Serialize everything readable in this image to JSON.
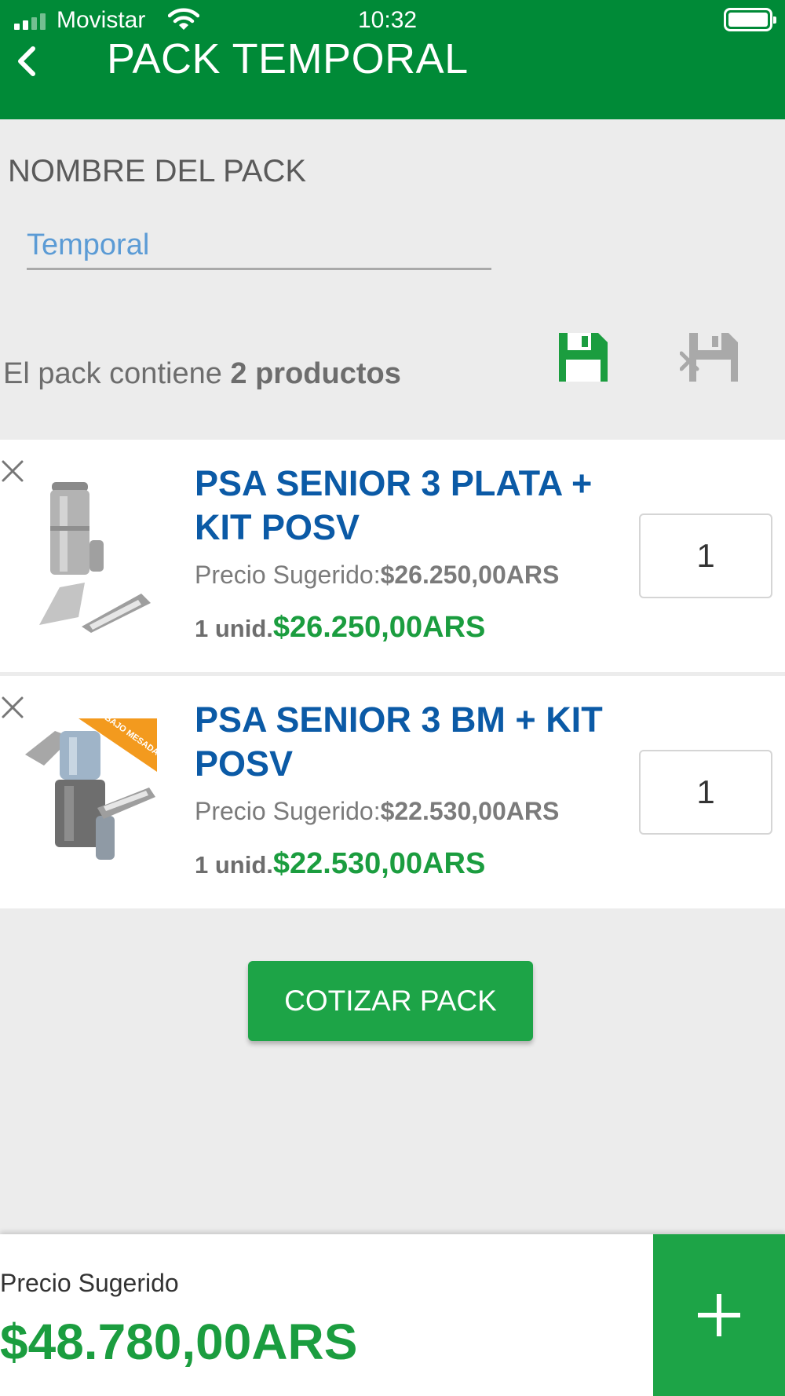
{
  "status_bar": {
    "carrier": "Movistar",
    "time": "10:32"
  },
  "header": {
    "title": "PACK TEMPORAL",
    "back_icon": "chevron-left-icon"
  },
  "pack_name": {
    "label": "NOMBRE DEL PACK",
    "value": "Temporal"
  },
  "summary": {
    "prefix": "El pack contiene",
    "count_text": "2 productos",
    "save_icon": "floppy-disk-icon",
    "discard_icon": "floppy-disk-remove-icon"
  },
  "products": [
    {
      "name": "PSA SENIOR 3 PLATA + KIT POSV",
      "suggested_label": "Precio Sugerido:",
      "suggested_price": "$26.250,00ARS",
      "unit_label": "1 unid.",
      "unit_price": "$26.250,00ARS",
      "quantity": "1"
    },
    {
      "name": "PSA SENIOR 3 BM + KIT POSV",
      "suggested_label": "Precio Sugerido:",
      "suggested_price": "$22.530,00ARS",
      "unit_label": "1 unid.",
      "unit_price": "$22.530,00ARS",
      "quantity": "1",
      "badge": "BAJO MESADA"
    }
  ],
  "actions": {
    "quote_label": "COTIZAR PACK"
  },
  "footer": {
    "label": "Precio Sugerido",
    "total": "$48.780,00ARS",
    "add_icon": "plus-icon"
  },
  "colors": {
    "header": "#008a37",
    "accent": "#1da447",
    "price": "#1b9d3f",
    "product_name": "#0b5aa6",
    "input_text": "#5b9bd5"
  }
}
